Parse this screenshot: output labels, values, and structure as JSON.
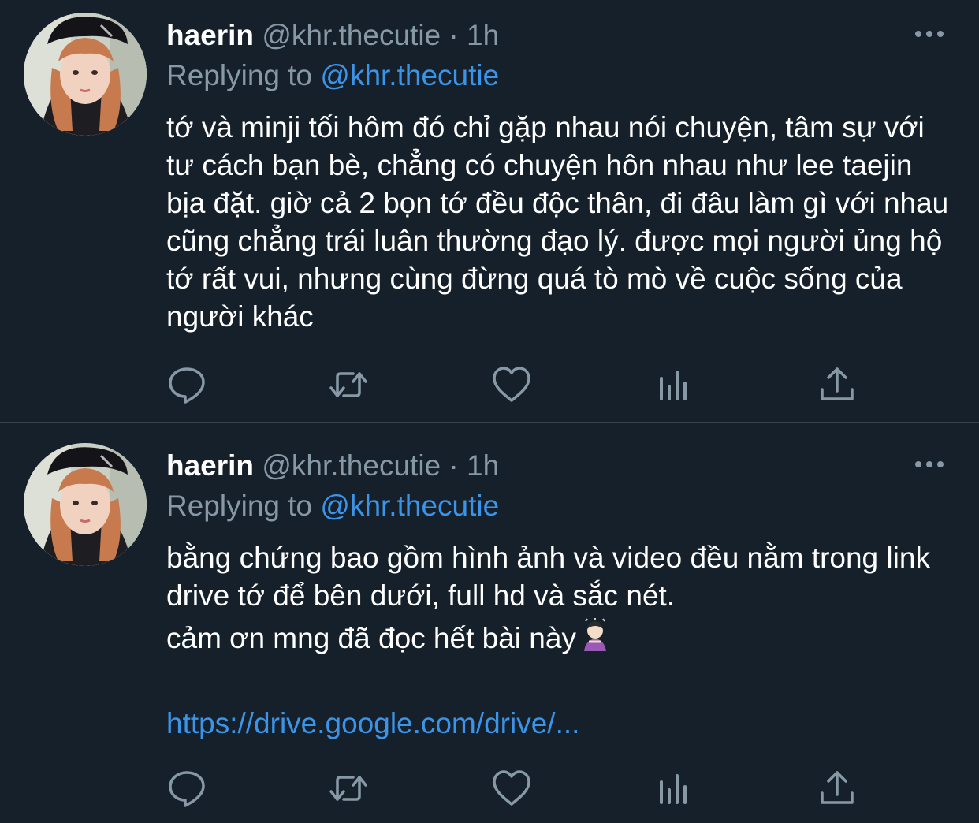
{
  "tweets": [
    {
      "display_name": "haerin",
      "handle": "@khr.thecutie",
      "separator": "·",
      "time": "1h",
      "reply_prefix": "Replying to",
      "reply_target": "@khr.thecutie",
      "text": "tớ và minji tối hôm đó chỉ gặp nhau nói chuyện, tâm sự với tư cách bạn bè, chẳng có chuyện hôn nhau như lee taejin bịa đặt. giờ cả 2 bọn tớ đều độc thân, đi đâu làm gì với nhau cũng chẳng trái luân thường đạo lý. được mọi người ủng hộ tớ rất vui, nhưng cùng đừng quá tò mò về cuộc sống của người khác"
    },
    {
      "display_name": "haerin",
      "handle": "@khr.thecutie",
      "separator": "·",
      "time": "1h",
      "reply_prefix": "Replying to",
      "reply_target": "@khr.thecutie",
      "text_line_1": "bằng chứng bao gồm hình ảnh và video đều nằm trong link drive tớ để bên dưới, full hd và sắc nét.",
      "text_line_2": "cảm ơn mng đã đọc hết bài này",
      "emoji": "person-bowing-emoji",
      "link": "https://drive.google.com/drive/..."
    }
  ],
  "icons": {
    "reply": "comment-bubble-icon",
    "retweet": "retweet-icon",
    "like": "heart-icon",
    "views": "bar-chart-icon",
    "share": "share-upload-icon",
    "more": "more-dots-icon"
  },
  "colors": {
    "background": "#15202b",
    "text": "#ffffff",
    "secondary": "#8899a6",
    "link": "#3b94e8",
    "divider": "#38444d"
  }
}
